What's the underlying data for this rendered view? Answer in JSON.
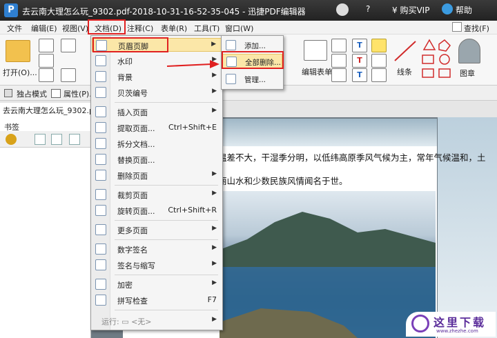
{
  "titlebar": {
    "logo": "P",
    "title": "去云南大理怎么玩_9302.pdf-2018-10-31-16-52-35-045 - 迅捷PDF编辑器",
    "help_mark": "?",
    "vip_label": "¥ 购买VIP",
    "help_label": "帮助"
  },
  "menubar": {
    "items": [
      "文件",
      "编辑(E)",
      "视图(V)",
      "文档(D)",
      "注释(C)",
      "表单(R)",
      "工具(T)",
      "窗口(W)"
    ],
    "find_label": "查找(F)"
  },
  "ribbon": {
    "open_label": "打开(O)...",
    "edit_form_label": "编辑表单",
    "line_label": "线条",
    "stamp_label": "图章"
  },
  "subtoolbar": {
    "exclusive_label": "独占模式",
    "properties_label": "属性(P)..."
  },
  "doc_tab": {
    "name": "去云南大理怎么玩_9302.pdf"
  },
  "sidebar": {
    "title": "书签"
  },
  "document": {
    "line1": "温差不大，干湿季分明，以低纬高原季风气候为主，常年气候温和，土",
    "line2": "丽山水和少数民族风情闻名于世。"
  },
  "doc_menu": {
    "items": [
      {
        "label": "页眉页脚",
        "shortcut": "",
        "arrow": "▶"
      },
      {
        "label": "水印",
        "shortcut": "",
        "arrow": "▶"
      },
      {
        "label": "背景",
        "shortcut": "",
        "arrow": "▶"
      },
      {
        "label": "贝茨编号",
        "shortcut": "",
        "arrow": "▶"
      },
      {
        "label": "插入页面",
        "shortcut": "",
        "arrow": "▶"
      },
      {
        "label": "提取页面...",
        "shortcut": "Ctrl+Shift+E",
        "arrow": ""
      },
      {
        "label": "拆分文档...",
        "shortcut": "",
        "arrow": ""
      },
      {
        "label": "替换页面...",
        "shortcut": "",
        "arrow": ""
      },
      {
        "label": "删除页面",
        "shortcut": "",
        "arrow": "▶"
      },
      {
        "label": "裁剪页面",
        "shortcut": "",
        "arrow": "▶"
      },
      {
        "label": "旋转页面...",
        "shortcut": "Ctrl+Shift+R",
        "arrow": ""
      },
      {
        "label": "更多页面",
        "shortcut": "",
        "arrow": "▶"
      },
      {
        "label": "数字签名",
        "shortcut": "",
        "arrow": "▶"
      },
      {
        "label": "签名与缩写",
        "shortcut": "",
        "arrow": "▶"
      },
      {
        "label": "加密",
        "shortcut": "",
        "arrow": "▶"
      },
      {
        "label": "拼写检查",
        "shortcut": "F7",
        "arrow": ""
      },
      {
        "label": "运行: ▭ <无>",
        "shortcut": "",
        "arrow": "▶"
      }
    ]
  },
  "submenu": {
    "items": [
      "添加...",
      "全部删除...",
      "管理..."
    ]
  },
  "watermark": {
    "text": "这里下载",
    "url": "www.zhezhe.com"
  },
  "colors": {
    "highlight_red": "#e02020",
    "titlebar": "#2a2a2a"
  }
}
